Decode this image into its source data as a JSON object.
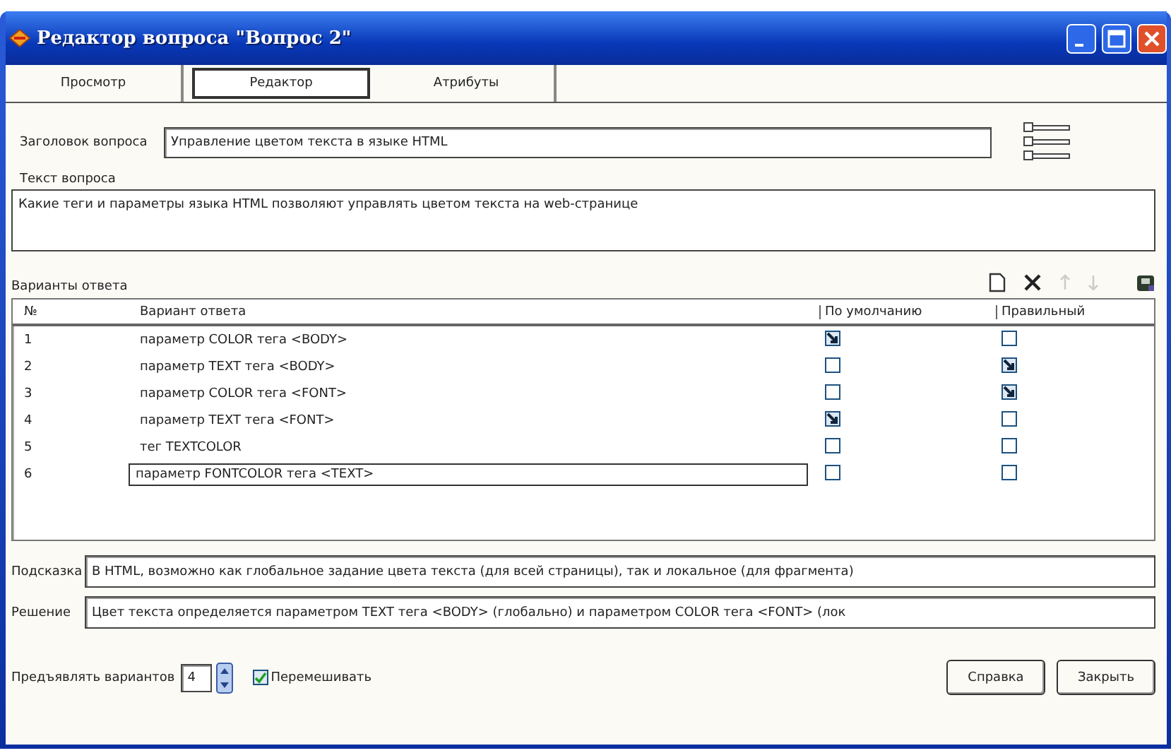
{
  "window": {
    "title": "Редактор вопроса \"Вопрос 2\""
  },
  "tabs": [
    {
      "label": "Просмотр",
      "selected": false
    },
    {
      "label": "Редактор",
      "selected": true
    },
    {
      "label": "Атрибуты",
      "selected": false
    }
  ],
  "question_title": {
    "label": "Заголовок вопроса",
    "value": "Управление цветом текста в языке HTML"
  },
  "question_text": {
    "label": "Текст вопроса",
    "value": "Какие теги и параметры языка HTML позволяют управлять цветом текста на web-странице"
  },
  "answers": {
    "label": "Варианты ответа",
    "toolbar": [
      {
        "kind": "new",
        "disabled": false
      },
      {
        "kind": "delete",
        "disabled": false
      },
      {
        "kind": "up",
        "disabled": true
      },
      {
        "kind": "down",
        "disabled": true
      },
      {
        "kind": "save",
        "disabled": false
      }
    ],
    "columns": [
      "№",
      "Вариант ответа",
      "По умолчанию",
      "Правильный"
    ],
    "rows": [
      {
        "number": "1",
        "text": "параметр COLOR тега <BODY>",
        "default": true,
        "correct": false,
        "editing": false
      },
      {
        "number": "2",
        "text": "параметр TEXT тега <BODY>",
        "default": false,
        "correct": true,
        "editing": false
      },
      {
        "number": "3",
        "text": "параметр COLOR тега <FONT>",
        "default": false,
        "correct": true,
        "editing": false
      },
      {
        "number": "4",
        "text": "параметр TEXT тега <FONT>",
        "default": true,
        "correct": false,
        "editing": false
      },
      {
        "number": "5",
        "text": "тег TEXTCOLOR",
        "default": false,
        "correct": false,
        "editing": false
      },
      {
        "number": "6",
        "text": "параметр FONTCOLOR тега <TEXT>",
        "default": false,
        "correct": false,
        "editing": true
      }
    ]
  },
  "hint": {
    "label": "Подсказка",
    "value": "В HTML, возможно как глобальное задание цвета текста (для всей страницы), так и локальное (для фрагмента)"
  },
  "solution": {
    "label": "Решение",
    "value": "Цвет текста определяется параметром TEXT тега <BODY> (глобально) и параметром COLOR тега <FONT> (лок"
  },
  "variants": {
    "label": "Предъявлять вариантов",
    "value": "4"
  },
  "shuffle": {
    "label": "Перемешивать",
    "checked": true
  },
  "buttons": [
    "Справка",
    "Закрыть"
  ]
}
